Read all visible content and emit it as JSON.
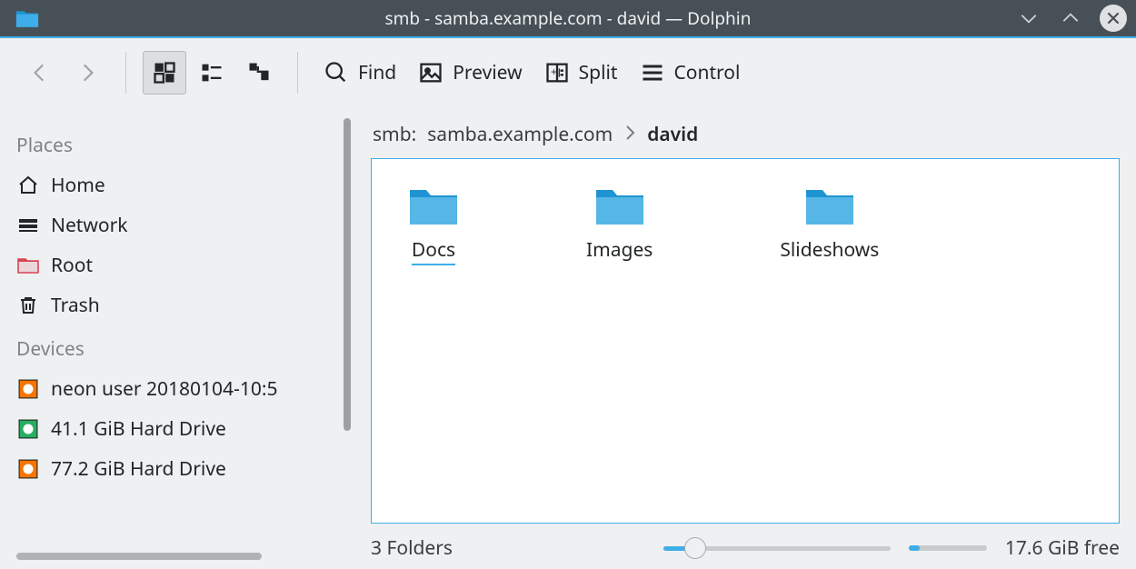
{
  "window": {
    "title": "smb - samba.example.com - david — Dolphin"
  },
  "toolbar": {
    "find": "Find",
    "preview": "Preview",
    "split": "Split",
    "control": "Control"
  },
  "sidebar": {
    "places_header": "Places",
    "devices_header": "Devices",
    "places": [
      {
        "label": "Home",
        "icon": "home-icon"
      },
      {
        "label": "Network",
        "icon": "network-icon"
      },
      {
        "label": "Root",
        "icon": "root-folder-icon"
      },
      {
        "label": "Trash",
        "icon": "trash-icon"
      }
    ],
    "devices": [
      {
        "label": "neon user 20180104-10:5",
        "icon": "disk-icon-orange"
      },
      {
        "label": "41.1 GiB Hard Drive",
        "icon": "disk-icon-green"
      },
      {
        "label": "77.2 GiB Hard Drive",
        "icon": "disk-icon-orange"
      }
    ]
  },
  "breadcrumb": {
    "scheme": "smb:",
    "host": "samba.example.com",
    "leaf": "david"
  },
  "folders": [
    {
      "name": "Docs",
      "selected": true
    },
    {
      "name": "Images",
      "selected": false
    },
    {
      "name": "Slideshows",
      "selected": false
    }
  ],
  "status": {
    "summary": "3 Folders",
    "free_space": "17.6 GiB free",
    "zoom_percent": 14,
    "disk_fill_percent": 14
  },
  "colors": {
    "accent": "#3daee9",
    "titlebar": "#475057"
  }
}
